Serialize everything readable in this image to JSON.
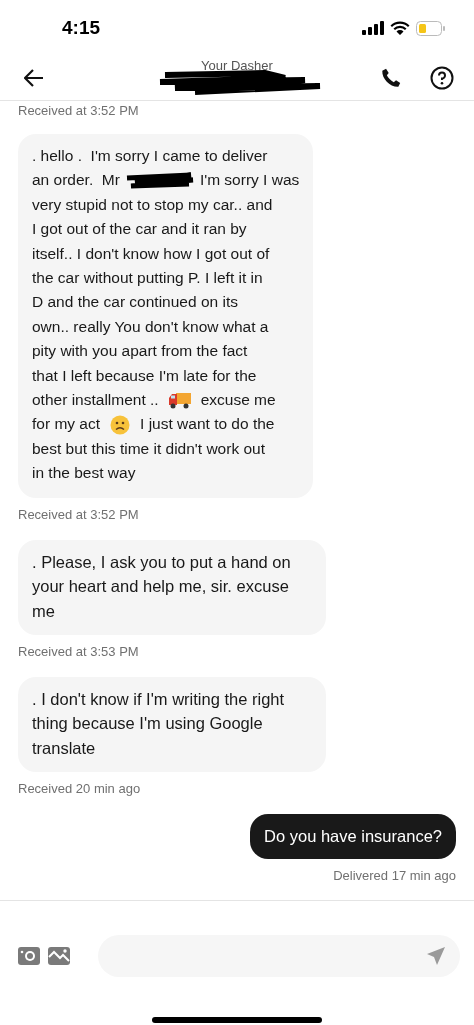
{
  "status_bar": {
    "time": "4:15"
  },
  "header": {
    "title": "Your Dasher"
  },
  "messages": [
    {
      "kind": "meta",
      "text": "Received at 3:52 PM"
    },
    {
      "kind": "incoming",
      "lines": [
        [
          {
            "kind": "text",
            "text": ". hello .  I'm sorry I came to deliver"
          }
        ],
        [
          {
            "kind": "text",
            "text": "an order.  Mr"
          },
          {
            "kind": "redaction"
          },
          {
            "kind": "text",
            "text": "I'm sorry I was"
          }
        ],
        [
          {
            "kind": "text",
            "text": "very stupid not to stop my car.. and"
          }
        ],
        [
          {
            "kind": "text",
            "text": "I got out of the car and it ran by"
          }
        ],
        [
          {
            "kind": "text",
            "text": "itself.. I don't know how I got out of"
          }
        ],
        [
          {
            "kind": "text",
            "text": "the car without putting P. I left it in"
          }
        ],
        [
          {
            "kind": "text",
            "text": "D and the car continued on its"
          }
        ],
        [
          {
            "kind": "text",
            "text": "own.. really You don't know what a"
          }
        ],
        [
          {
            "kind": "text",
            "text": "pity with you apart from the fact"
          }
        ],
        [
          {
            "kind": "text",
            "text": "that I left because I'm late for the"
          }
        ],
        [
          {
            "kind": "text",
            "text": "other installment .."
          },
          {
            "kind": "truck"
          },
          {
            "kind": "text",
            "text": "excuse me"
          }
        ],
        [
          {
            "kind": "text",
            "text": "for my act"
          },
          {
            "kind": "frown"
          },
          {
            "kind": "text",
            "text": "I just want to do the"
          }
        ],
        [
          {
            "kind": "text",
            "text": "best but this time it didn't work out"
          }
        ],
        [
          {
            "kind": "text",
            "text": "in the best way"
          }
        ]
      ]
    },
    {
      "kind": "meta",
      "text": "Received at 3:52 PM"
    },
    {
      "kind": "incoming",
      "parts": [
        {
          "kind": "text",
          "text": ". Please, I ask you to put a hand on your heart and help me, sir.  excuse me"
        }
      ]
    },
    {
      "kind": "meta",
      "text": "Received at 3:53 PM"
    },
    {
      "kind": "incoming",
      "parts": [
        {
          "kind": "text",
          "text": ". I don't know if I'm writing the right thing because I'm using Google translate"
        }
      ]
    },
    {
      "kind": "meta",
      "text": "Received 20 min ago"
    },
    {
      "kind": "outgoing",
      "parts": [
        {
          "kind": "text",
          "text": "Do you have insurance?"
        }
      ]
    },
    {
      "kind": "meta_out",
      "text": "Delivered 17 min ago"
    }
  ]
}
